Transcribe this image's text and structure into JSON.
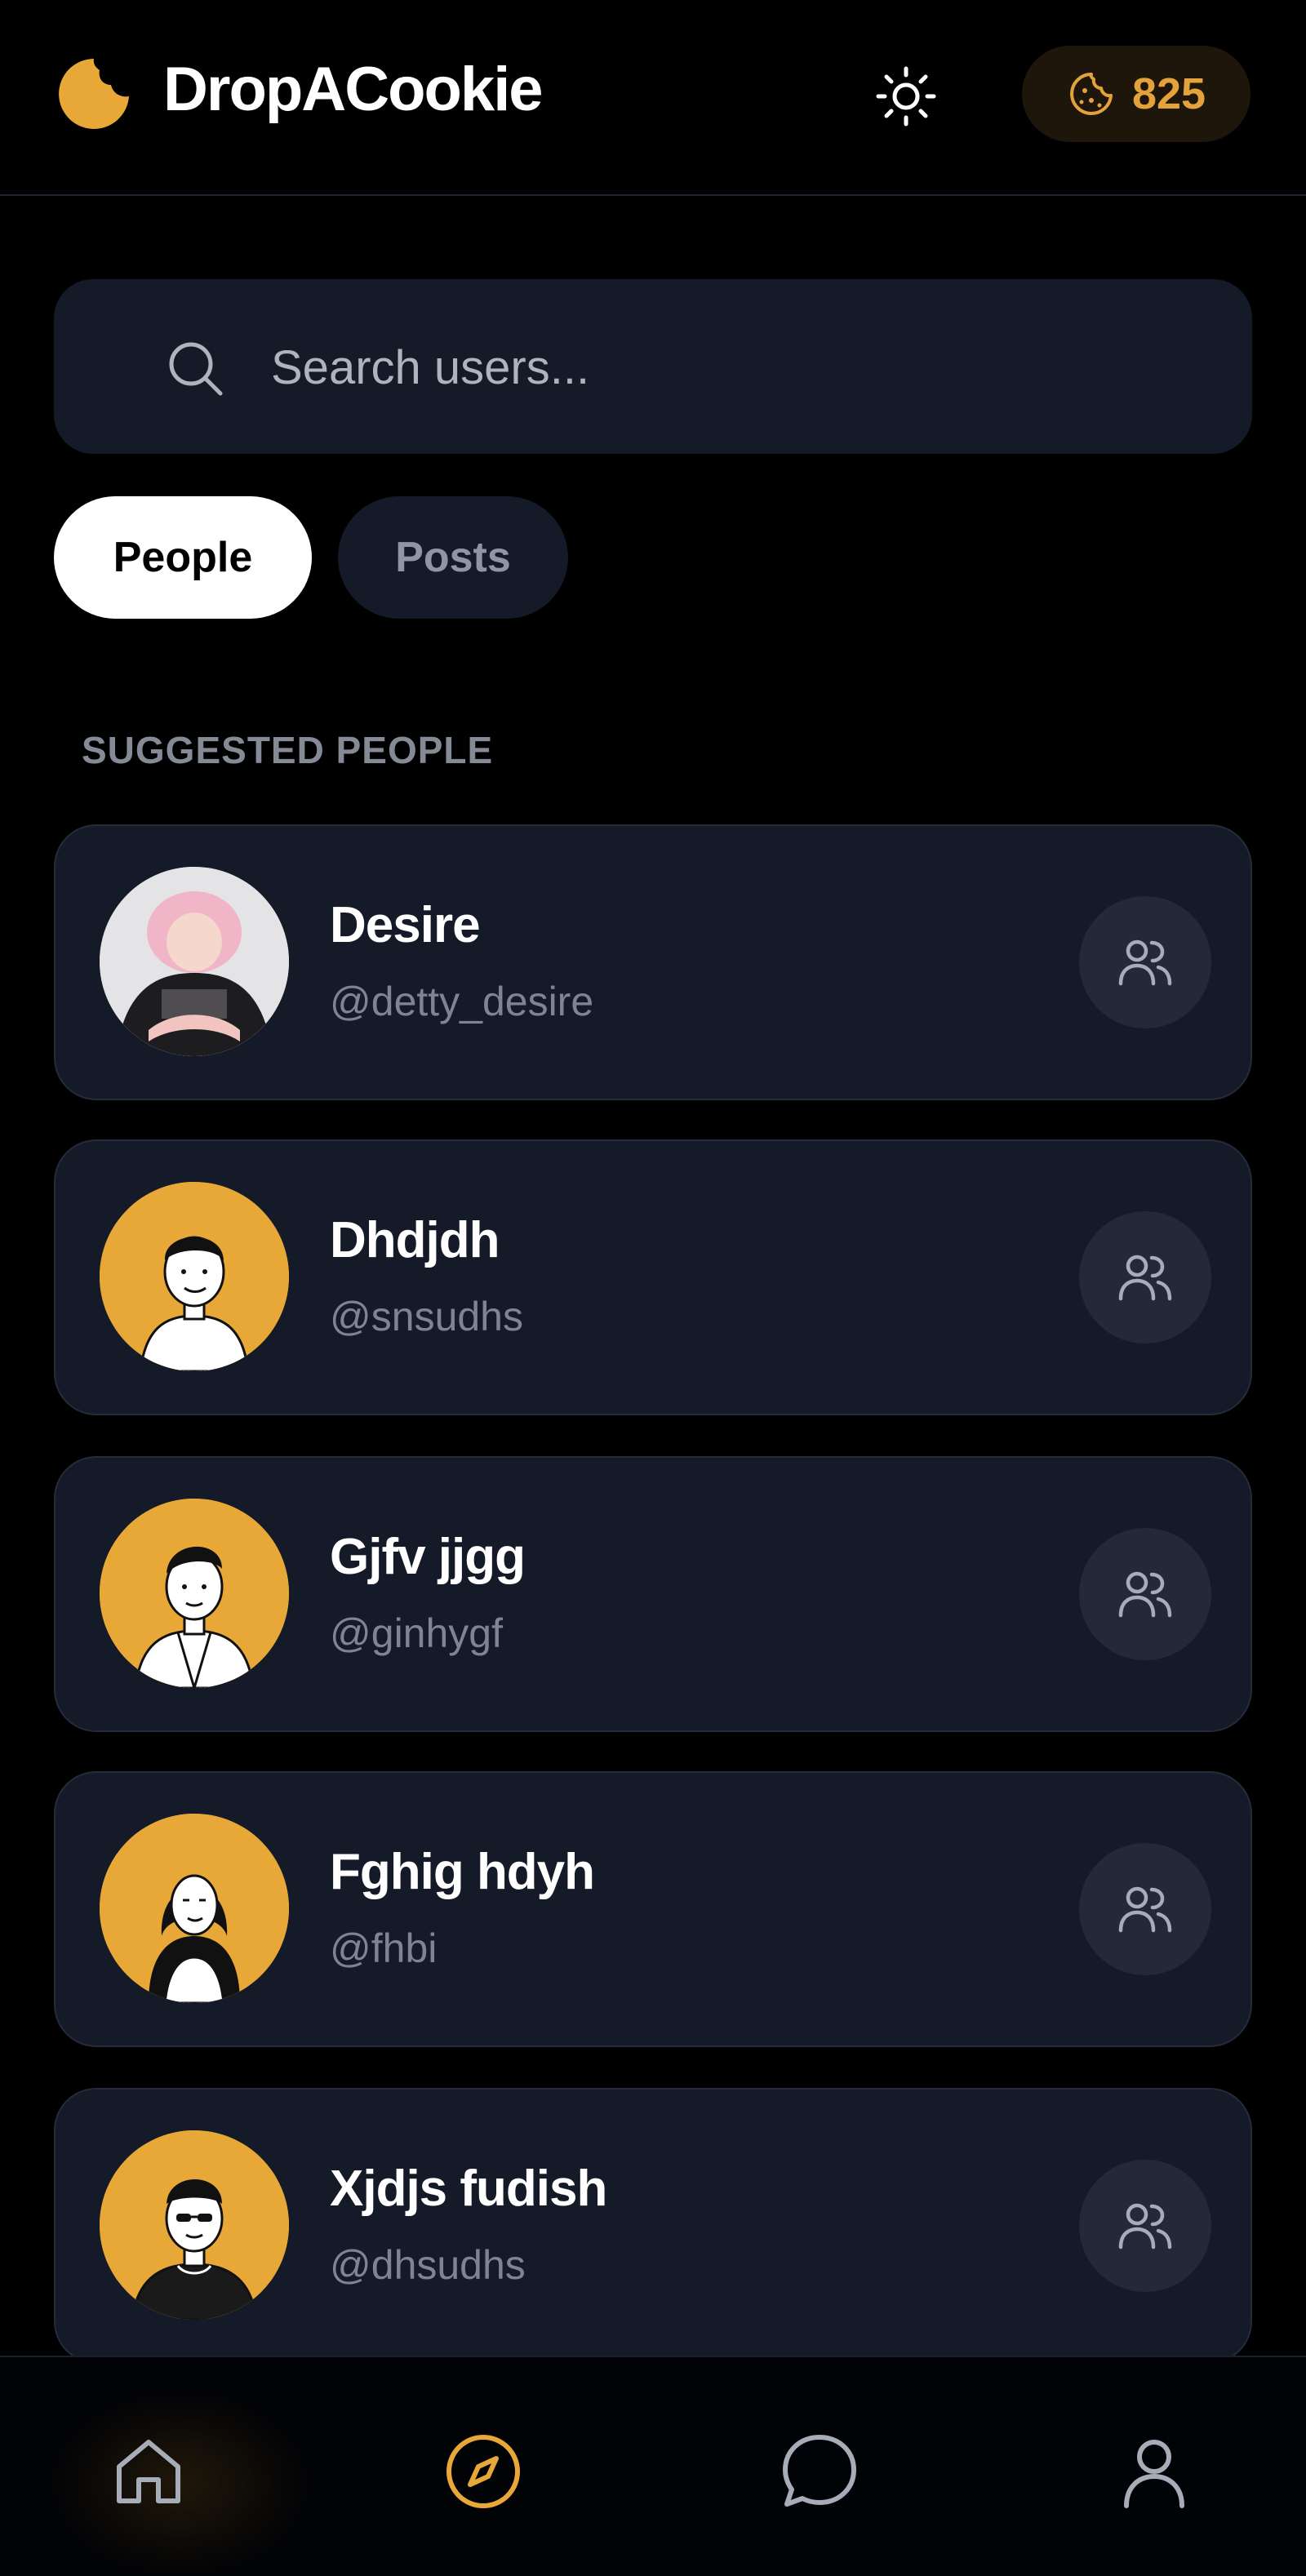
{
  "header": {
    "brand": "DropACookie",
    "cookie_count": "825",
    "theme_icon": "sun-icon",
    "accent_color": "#e8a838"
  },
  "search": {
    "placeholder": "Search users..."
  },
  "tabs": [
    {
      "label": "People",
      "active": true
    },
    {
      "label": "Posts",
      "active": false
    }
  ],
  "section": {
    "heading": "SUGGESTED PEOPLE"
  },
  "users": [
    {
      "name": "Desire",
      "handle": "@detty_desire",
      "avatar": "photo-avatar"
    },
    {
      "name": "Dhdjdh",
      "handle": "@snsudhs",
      "avatar": "illustrated-avatar"
    },
    {
      "name": "Gjfv jjgg",
      "handle": "@ginhygf",
      "avatar": "illustrated-avatar"
    },
    {
      "name": "Fghig hdyh",
      "handle": "@fhbi",
      "avatar": "illustrated-avatar"
    },
    {
      "name": "Xjdjs fudish",
      "handle": "@dhsudhs",
      "avatar": "illustrated-avatar"
    }
  ],
  "bottom_nav": [
    {
      "icon": "home-icon",
      "active": false
    },
    {
      "icon": "compass-icon",
      "active": true
    },
    {
      "icon": "chat-icon",
      "active": false
    },
    {
      "icon": "profile-icon",
      "active": false
    }
  ]
}
